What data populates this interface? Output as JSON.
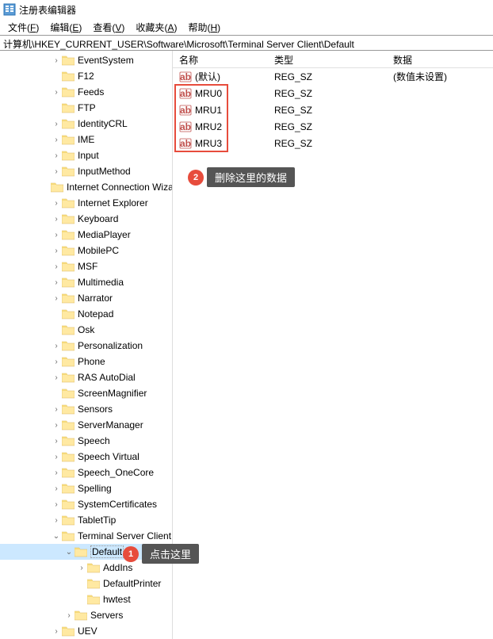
{
  "titlebar": {
    "text": "注册表编辑器"
  },
  "menu": {
    "file": {
      "label": "文件",
      "key": "F"
    },
    "edit": {
      "label": "编辑",
      "key": "E"
    },
    "view": {
      "label": "查看",
      "key": "V"
    },
    "favorites": {
      "label": "收藏夹",
      "key": "A"
    },
    "help": {
      "label": "帮助",
      "key": "H"
    }
  },
  "path": "计算机\\HKEY_CURRENT_USER\\Software\\Microsoft\\Terminal Server Client\\Default",
  "tree": {
    "items": [
      {
        "label": "EventSystem",
        "indent": 64,
        "arrow": ">"
      },
      {
        "label": "F12",
        "indent": 64,
        "arrow": ""
      },
      {
        "label": "Feeds",
        "indent": 64,
        "arrow": ">"
      },
      {
        "label": "FTP",
        "indent": 64,
        "arrow": ""
      },
      {
        "label": "IdentityCRL",
        "indent": 64,
        "arrow": ">"
      },
      {
        "label": "IME",
        "indent": 64,
        "arrow": ">"
      },
      {
        "label": "Input",
        "indent": 64,
        "arrow": ">"
      },
      {
        "label": "InputMethod",
        "indent": 64,
        "arrow": ">"
      },
      {
        "label": "Internet Connection Wizard",
        "indent": 64,
        "arrow": ""
      },
      {
        "label": "Internet Explorer",
        "indent": 64,
        "arrow": ">"
      },
      {
        "label": "Keyboard",
        "indent": 64,
        "arrow": ">"
      },
      {
        "label": "MediaPlayer",
        "indent": 64,
        "arrow": ">"
      },
      {
        "label": "MobilePC",
        "indent": 64,
        "arrow": ">"
      },
      {
        "label": "MSF",
        "indent": 64,
        "arrow": ">"
      },
      {
        "label": "Multimedia",
        "indent": 64,
        "arrow": ">"
      },
      {
        "label": "Narrator",
        "indent": 64,
        "arrow": ">"
      },
      {
        "label": "Notepad",
        "indent": 64,
        "arrow": ""
      },
      {
        "label": "Osk",
        "indent": 64,
        "arrow": ""
      },
      {
        "label": "Personalization",
        "indent": 64,
        "arrow": ">"
      },
      {
        "label": "Phone",
        "indent": 64,
        "arrow": ">"
      },
      {
        "label": "RAS AutoDial",
        "indent": 64,
        "arrow": ">"
      },
      {
        "label": "ScreenMagnifier",
        "indent": 64,
        "arrow": ""
      },
      {
        "label": "Sensors",
        "indent": 64,
        "arrow": ">"
      },
      {
        "label": "ServerManager",
        "indent": 64,
        "arrow": ">"
      },
      {
        "label": "Speech",
        "indent": 64,
        "arrow": ">"
      },
      {
        "label": "Speech Virtual",
        "indent": 64,
        "arrow": ">"
      },
      {
        "label": "Speech_OneCore",
        "indent": 64,
        "arrow": ">"
      },
      {
        "label": "Spelling",
        "indent": 64,
        "arrow": ">"
      },
      {
        "label": "SystemCertificates",
        "indent": 64,
        "arrow": ">"
      },
      {
        "label": "TabletTip",
        "indent": 64,
        "arrow": ">"
      },
      {
        "label": "Terminal Server Client",
        "indent": 64,
        "arrow": "v"
      },
      {
        "label": "Default",
        "indent": 80,
        "arrow": "v",
        "selected": true
      },
      {
        "label": "AddIns",
        "indent": 96,
        "arrow": ">"
      },
      {
        "label": "DefaultPrinter",
        "indent": 96,
        "arrow": ""
      },
      {
        "label": "hwtest",
        "indent": 96,
        "arrow": ""
      },
      {
        "label": "Servers",
        "indent": 80,
        "arrow": ">"
      },
      {
        "label": "UEV",
        "indent": 64,
        "arrow": ">"
      }
    ]
  },
  "list": {
    "columns": {
      "name": "名称",
      "type": "类型",
      "data": "数据"
    },
    "rows": [
      {
        "name": "(默认)",
        "type": "REG_SZ",
        "data": "(数值未设置)"
      },
      {
        "name": "MRU0",
        "type": "REG_SZ",
        "data": ""
      },
      {
        "name": "MRU1",
        "type": "REG_SZ",
        "data": ""
      },
      {
        "name": "MRU2",
        "type": "REG_SZ",
        "data": ""
      },
      {
        "name": "MRU3",
        "type": "REG_SZ",
        "data": ""
      }
    ]
  },
  "annotations": {
    "anno1": {
      "num": "1",
      "text": "点击这里"
    },
    "anno2": {
      "num": "2",
      "text": "删除这里的数据"
    }
  }
}
